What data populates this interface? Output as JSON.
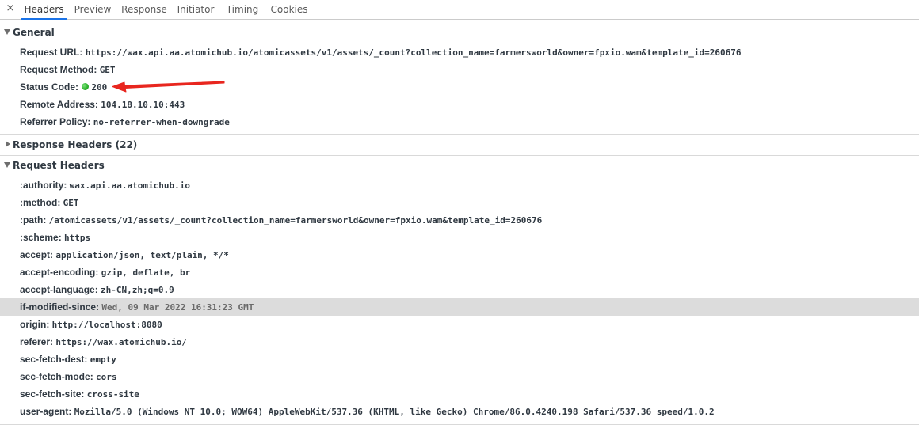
{
  "tabs": {
    "close_icon": "×",
    "items": [
      "Headers",
      "Preview",
      "Response",
      "Initiator",
      "Timing",
      "Cookies"
    ],
    "active": "Headers"
  },
  "general": {
    "title": "General",
    "rows": [
      {
        "key": "Request URL:",
        "value": "https://wax.api.aa.atomichub.io/atomicassets/v1/assets/_count?collection_name=farmersworld&owner=fpxio.wam&template_id=260676"
      },
      {
        "key": "Request Method:",
        "value": "GET"
      },
      {
        "key": "Status Code:",
        "value": "200"
      },
      {
        "key": "Remote Address:",
        "value": "104.18.10.10:443"
      },
      {
        "key": "Referrer Policy:",
        "value": "no-referrer-when-downgrade"
      }
    ]
  },
  "response_headers": {
    "title": "Response Headers (22)",
    "expanded": false
  },
  "request_headers": {
    "title": "Request Headers",
    "rows": [
      {
        "key": ":authority:",
        "value": "wax.api.aa.atomichub.io"
      },
      {
        "key": ":method:",
        "value": "GET"
      },
      {
        "key": ":path:",
        "value": "/atomicassets/v1/assets/_count?collection_name=farmersworld&owner=fpxio.wam&template_id=260676"
      },
      {
        "key": ":scheme:",
        "value": "https"
      },
      {
        "key": "accept:",
        "value": "application/json, text/plain, */*"
      },
      {
        "key": "accept-encoding:",
        "value": "gzip, deflate, br"
      },
      {
        "key": "accept-language:",
        "value": "zh-CN,zh;q=0.9"
      },
      {
        "key": "if-modified-since:",
        "value": "Wed, 09 Mar 2022 16:31:23 GMT"
      },
      {
        "key": "origin:",
        "value": "http://localhost:8080"
      },
      {
        "key": "referer:",
        "value": "https://wax.atomichub.io/"
      },
      {
        "key": "sec-fetch-dest:",
        "value": "empty"
      },
      {
        "key": "sec-fetch-mode:",
        "value": "cors"
      },
      {
        "key": "sec-fetch-site:",
        "value": "cross-site"
      },
      {
        "key": "user-agent:",
        "value": "Mozilla/5.0 (Windows NT 10.0; WOW64) AppleWebKit/537.36 (KHTML, like Gecko) Chrome/86.0.4240.198 Safari/537.36 speed/1.0.2"
      }
    ],
    "highlighted_key": "if-modified-since:"
  },
  "colors": {
    "status_ok": "#2fb52f",
    "annotation_arrow": "#e8261f",
    "tab_underline": "#1a73e8",
    "highlight_row": "#dcdcdc"
  },
  "icons": {
    "status": "green-dot-icon",
    "expanded": "triangle-down-icon",
    "collapsed": "triangle-right-icon"
  }
}
